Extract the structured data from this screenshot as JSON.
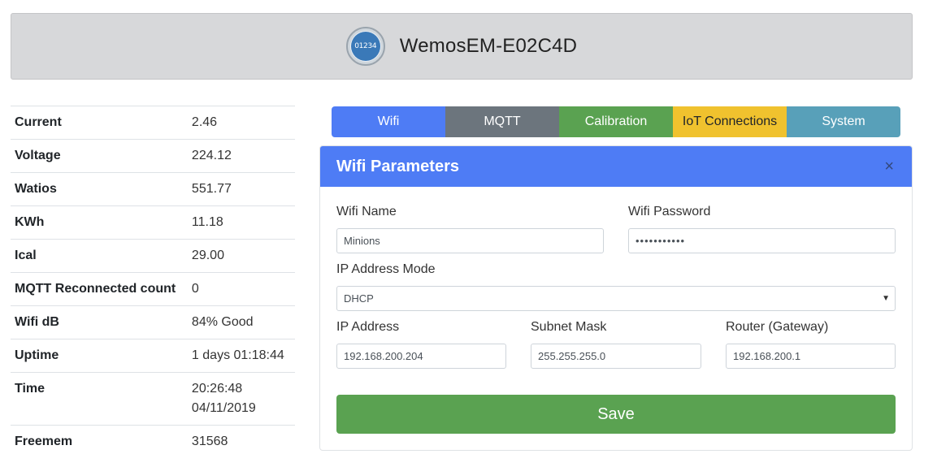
{
  "header": {
    "logo_text": "01234",
    "device_name": "WemosEM-E02C4D"
  },
  "stats": [
    {
      "key": "Current",
      "value": "2.46"
    },
    {
      "key": "Voltage",
      "value": "224.12"
    },
    {
      "key": "Watios",
      "value": "551.77"
    },
    {
      "key": "KWh",
      "value": "11.18"
    },
    {
      "key": "Ical",
      "value": "29.00"
    },
    {
      "key": "MQTT Reconnected count",
      "value": "0"
    },
    {
      "key": "Wifi dB",
      "value": "84% Good"
    },
    {
      "key": "Uptime",
      "value": "1 days 01:18:44"
    },
    {
      "key": "Time",
      "value": "20:26:48 04/11/2019"
    },
    {
      "key": "Freemem",
      "value": "31568"
    }
  ],
  "tabs": [
    "Wifi",
    "MQTT",
    "Calibration",
    "IoT Connections",
    "System"
  ],
  "colors": {
    "wifi": "#4e7cf5",
    "mqtt": "#6c757d",
    "calibration": "#5aa251",
    "iot": "#f0c22e",
    "system": "#58a0b9",
    "save": "#5aa251"
  },
  "panel": {
    "title": "Wifi Parameters",
    "close_icon": "×",
    "wifi_name_label": "Wifi Name",
    "wifi_name_value": "Minions",
    "wifi_password_label": "Wifi Password",
    "wifi_password_value": "•••••••••••",
    "ip_mode_label": "IP Address Mode",
    "ip_mode_value": "DHCP",
    "ip_address_label": "IP Address",
    "ip_address_value": "192.168.200.204",
    "subnet_label": "Subnet Mask",
    "subnet_value": "255.255.255.0",
    "router_label": "Router (Gateway)",
    "router_value": "192.168.200.1",
    "save_label": "Save"
  }
}
